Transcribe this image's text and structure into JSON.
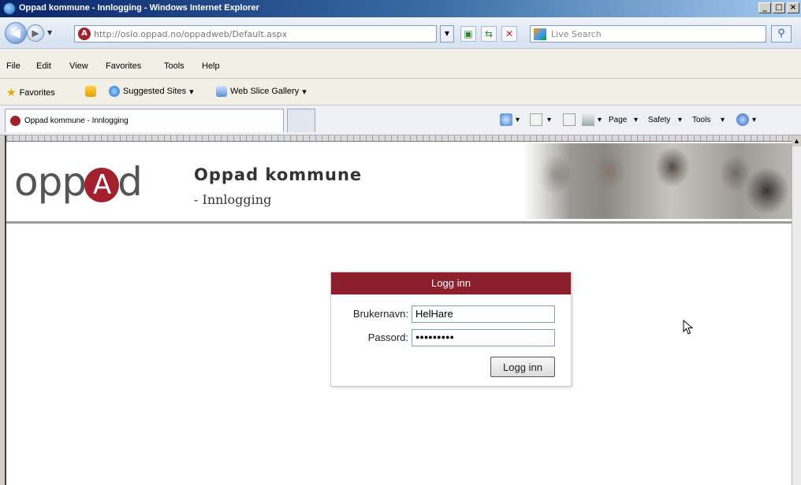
{
  "window": {
    "title": "Oppad kommune - Innlogging - Windows Internet Explorer",
    "controls": [
      "_",
      "□",
      "×"
    ]
  },
  "addressbar": {
    "url": "http://oslo.oppad.no/oppadweb/Default.aspx",
    "search_placeholder": "Live Search"
  },
  "menu": [
    "File",
    "Edit",
    "View",
    "Favorites",
    "Tools",
    "Help"
  ],
  "favorites_bar": {
    "favorites_label": "Favorites",
    "suggested_sites": "Suggested Sites",
    "web_slice": "Web Slice Gallery"
  },
  "tab": {
    "label": "Oppad kommune - Innlogging"
  },
  "command_bar": [
    "Page",
    "Safety",
    "Tools"
  ],
  "header": {
    "logo_left": "opp",
    "logo_mark": "A",
    "logo_right": "d",
    "title": "Oppad kommune",
    "subtitle": "- Innlogging"
  },
  "login": {
    "heading": "Logg inn",
    "username_label": "Brukernavn:",
    "username_value": "HelHare",
    "password_label": "Passord:",
    "password_mask": "●●●●●●●●●",
    "submit_label": "Logg inn"
  },
  "colors": {
    "brand": "#8b1f2d",
    "titlebar": "#0a246a"
  }
}
